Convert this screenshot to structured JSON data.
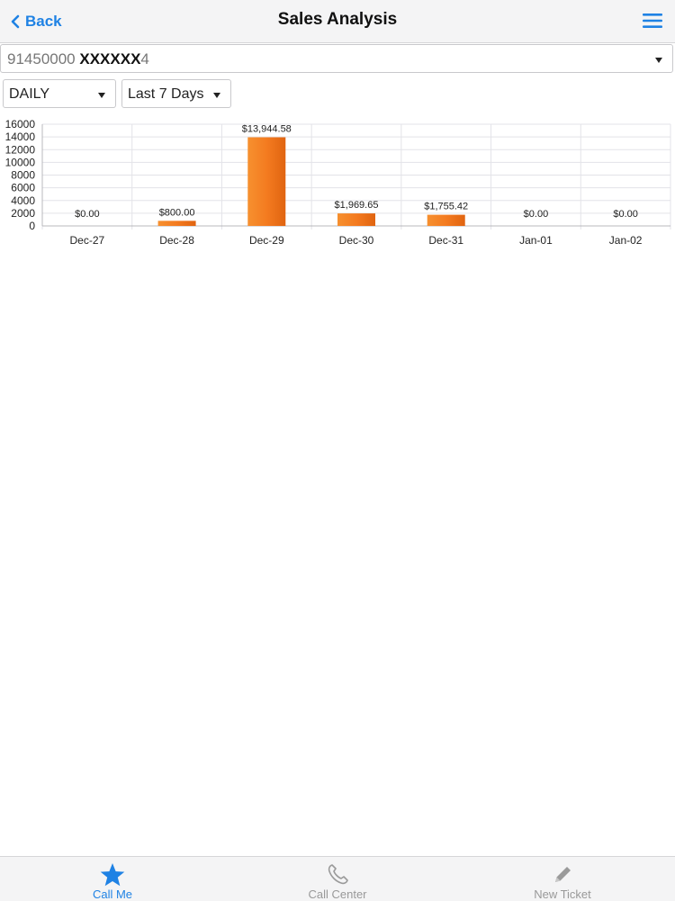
{
  "navbar": {
    "back_label": "Back",
    "title": "Sales Analysis"
  },
  "account": {
    "prefix": "91450000",
    "masked": "XXXXXX",
    "suffix": "4"
  },
  "filters": {
    "period": "DAILY",
    "range": "Last 7 Days"
  },
  "chart_data": {
    "type": "bar",
    "categories": [
      "Dec-27",
      "Dec-28",
      "Dec-29",
      "Dec-30",
      "Dec-31",
      "Jan-01",
      "Jan-02"
    ],
    "values": [
      0,
      800,
      13944.58,
      1969.65,
      1755.42,
      0,
      0
    ],
    "data_labels": [
      "$0.00",
      "$800.00",
      "$13,944.58",
      "$1,969.65",
      "$1,755.42",
      "$0.00",
      "$0.00"
    ],
    "yticks": [
      0,
      2000,
      4000,
      6000,
      8000,
      10000,
      12000,
      14000,
      16000
    ],
    "ylim": [
      0,
      16000
    ],
    "grid": true,
    "bar_color": "#f47b20"
  },
  "tabs": [
    {
      "label": "Call Me",
      "icon": "star-icon",
      "active": true
    },
    {
      "label": "Call Center",
      "icon": "phone-icon",
      "active": false
    },
    {
      "label": "New Ticket",
      "icon": "pencil-icon",
      "active": false
    }
  ],
  "colors": {
    "accent": "#1f82e4",
    "inactive": "#999999",
    "bar": "#f47b20"
  }
}
